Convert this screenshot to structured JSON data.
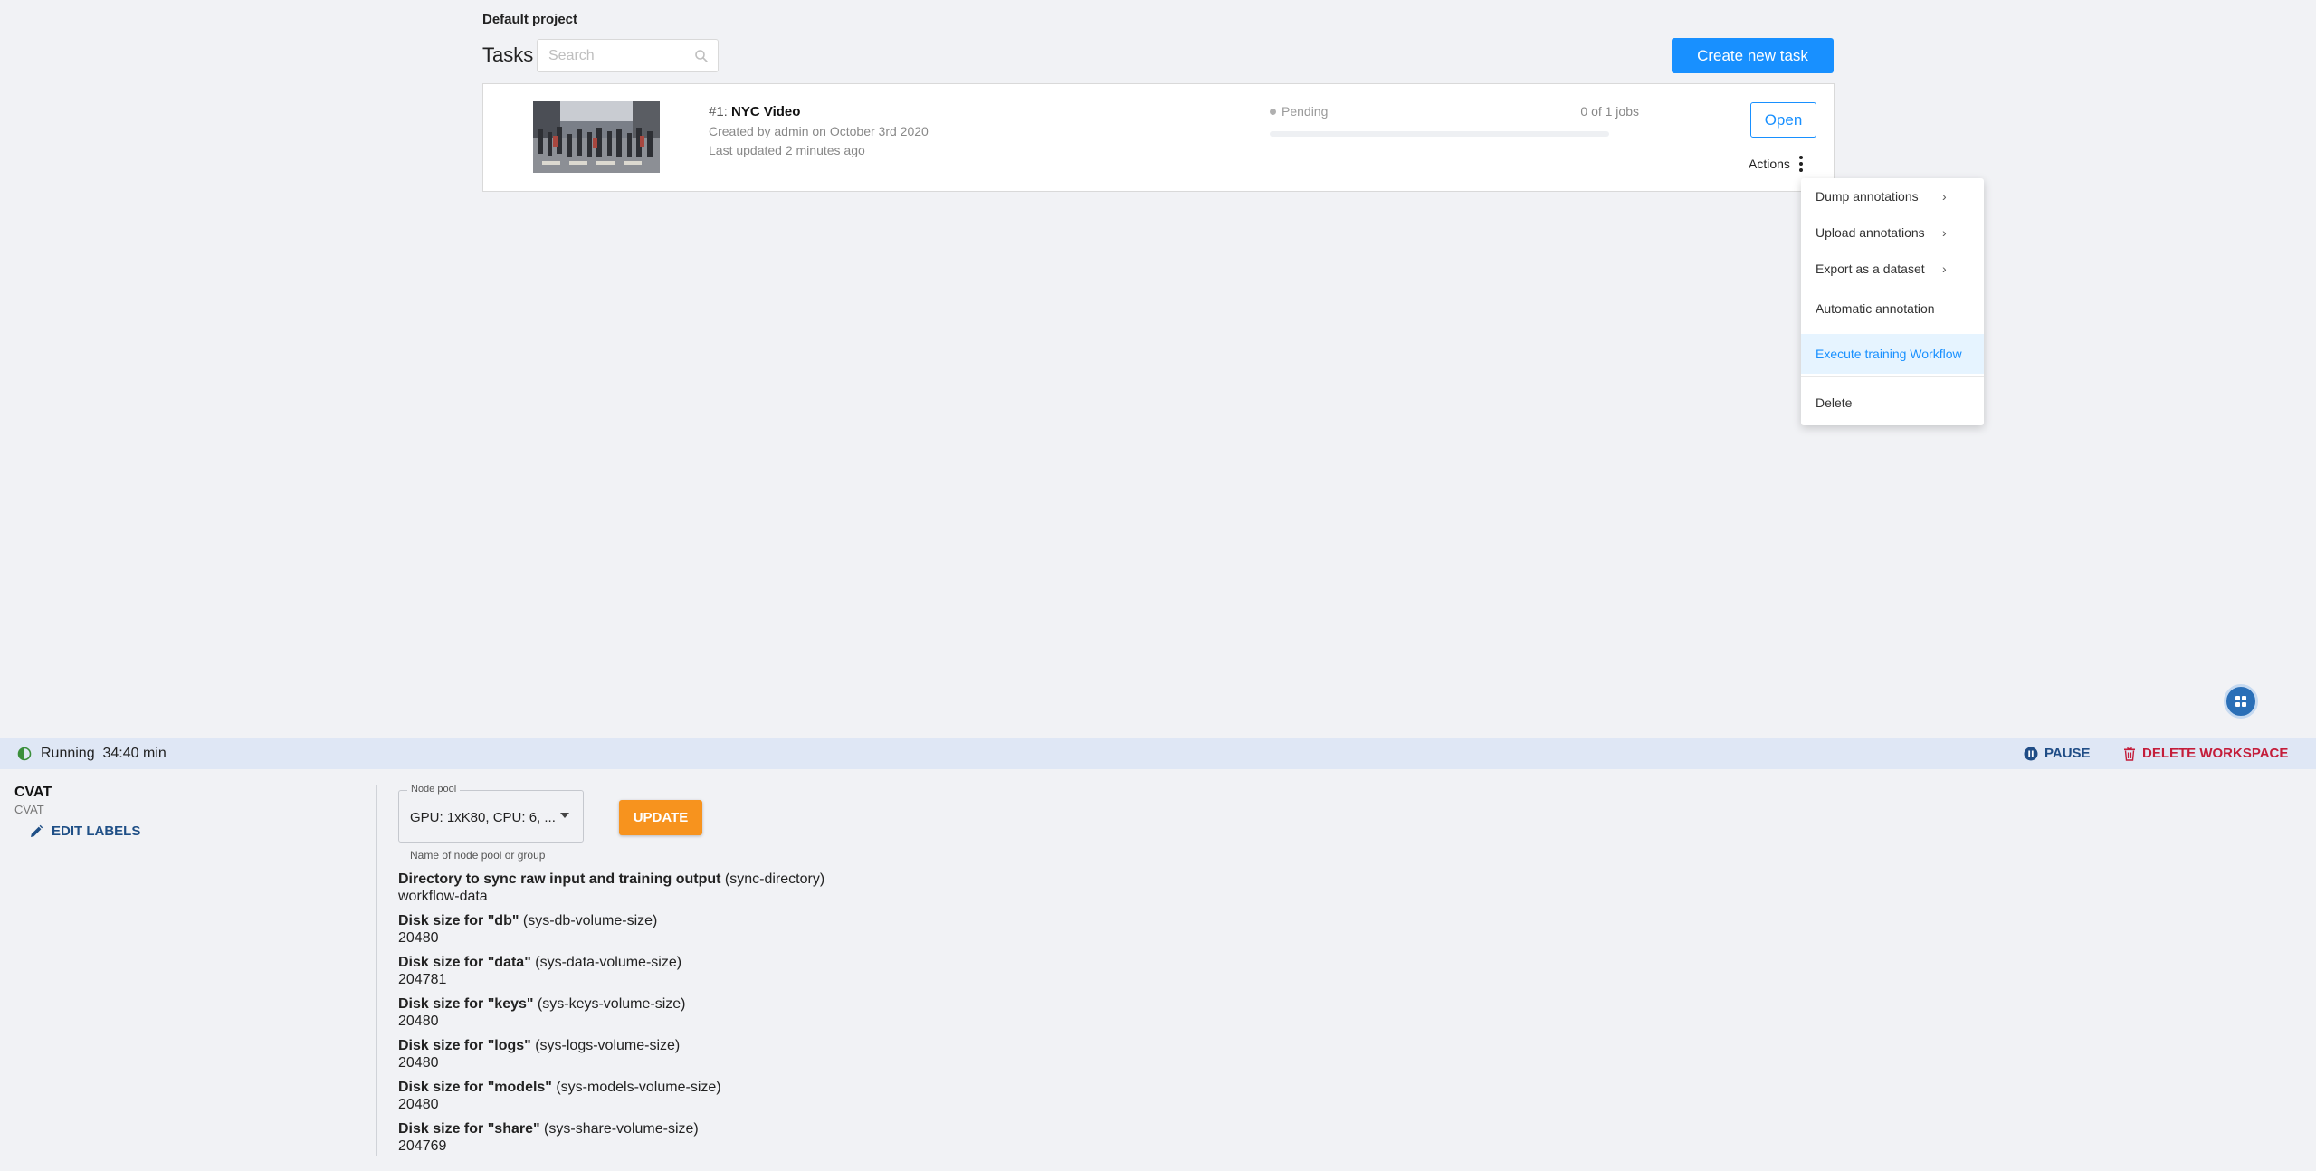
{
  "project": {
    "title": "Default project"
  },
  "tasks": {
    "heading": "Tasks",
    "search_placeholder": "Search",
    "create_button": "Create new task"
  },
  "task": {
    "id_prefix": "#1: ",
    "name": "NYC Video",
    "created": "Created by admin on October 3rd 2020",
    "updated": "Last updated 2 minutes ago",
    "status": "Pending",
    "jobs": "0 of 1 jobs",
    "progress": 0,
    "open_button": "Open",
    "actions_label": "Actions"
  },
  "actions_menu": {
    "items": [
      {
        "label": "Dump annotations",
        "submenu": true
      },
      {
        "label": "Upload annotations",
        "submenu": true
      },
      {
        "label": "Export as a dataset",
        "submenu": true
      },
      {
        "label": "Automatic annotation",
        "submenu": false
      },
      {
        "label": "Execute training Workflow",
        "submenu": false,
        "highlighted": true
      },
      {
        "label": "Delete",
        "submenu": false
      }
    ],
    "submenu_glyph": "›"
  },
  "status_bar": {
    "state": "Running",
    "duration": "34:40 min",
    "pause_button": "PAUSE",
    "delete_button": "DELETE WORKSPACE"
  },
  "workspace": {
    "name": "CVAT",
    "template": "CVAT",
    "edit_labels_button": "EDIT LABELS",
    "node_pool": {
      "legend": "Node pool",
      "value": "GPU: 1xK80, CPU: 6, ...",
      "hint": "Name of node pool or group"
    },
    "update_button": "UPDATE",
    "parameters": [
      {
        "label": "Directory to sync raw input and training output",
        "key": "(sync-directory)",
        "value": "workflow-data"
      },
      {
        "label": "Disk size for \"db\"",
        "key": "(sys-db-volume-size)",
        "value": "20480"
      },
      {
        "label": "Disk size for \"data\"",
        "key": "(sys-data-volume-size)",
        "value": "204781"
      },
      {
        "label": "Disk size for \"keys\"",
        "key": "(sys-keys-volume-size)",
        "value": "20480"
      },
      {
        "label": "Disk size for \"logs\"",
        "key": "(sys-logs-volume-size)",
        "value": "20480"
      },
      {
        "label": "Disk size for \"models\"",
        "key": "(sys-models-volume-size)",
        "value": "20480"
      },
      {
        "label": "Disk size for \"share\"",
        "key": "(sys-share-volume-size)",
        "value": "204769"
      }
    ]
  },
  "colors": {
    "primary": "#1890ff",
    "update_orange": "#f7931e",
    "delete_red": "#c41d3a",
    "pause_blue": "#204d86",
    "status_bar_bg": "#dfe7f5"
  },
  "icons": {
    "search": "search-icon",
    "kebab": "kebab-menu-icon",
    "pause": "pause-icon",
    "trash": "trash-icon",
    "pencil": "pencil-icon",
    "running": "half-circle-icon",
    "apps": "apps-grid-icon"
  }
}
